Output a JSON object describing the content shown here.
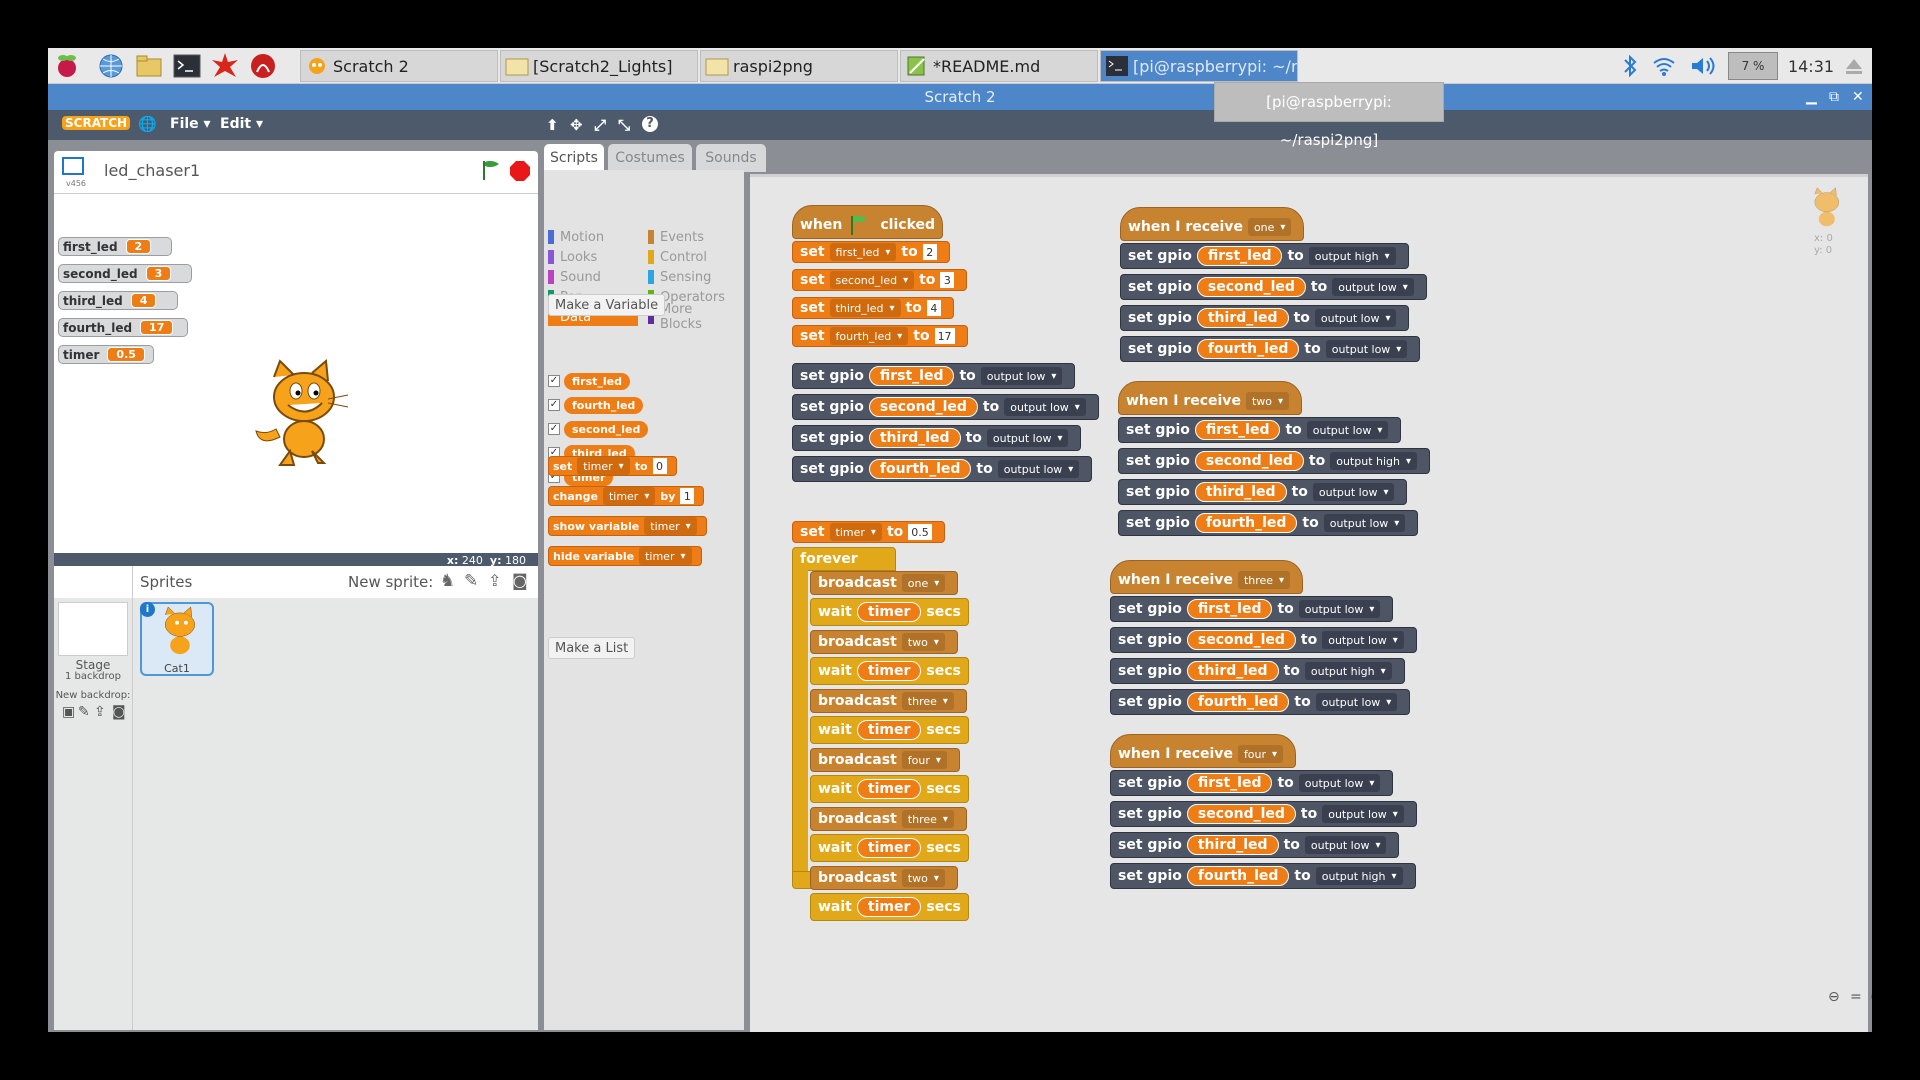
{
  "taskbar": {
    "buttons": [
      {
        "label": "Scratch 2"
      },
      {
        "label": "[Scratch2_Lights]"
      },
      {
        "label": "raspi2png"
      },
      {
        "label": "*README.md"
      },
      {
        "label": "[pi@raspberrypi: ~/ra..."
      }
    ],
    "cpu": "7 %",
    "clock": "14:31",
    "tooltip": "[pi@raspberrypi: ~/raspi2png]"
  },
  "window": {
    "title": "Scratch 2"
  },
  "menu": {
    "logo": "SCRATCH",
    "file": "File",
    "edit": "Edit"
  },
  "stage": {
    "project_name": "led_chaser1",
    "version": "v456",
    "coords_x": "240",
    "coords_y": "180",
    "monitors": [
      {
        "name": "first_led",
        "value": "2"
      },
      {
        "name": "second_led",
        "value": "3"
      },
      {
        "name": "third_led",
        "value": "4"
      },
      {
        "name": "fourth_led",
        "value": "17"
      },
      {
        "name": "timer",
        "value": "0.5"
      }
    ]
  },
  "sprites": {
    "title": "Sprites",
    "new_sprite": "New sprite:",
    "stage_label": "Stage",
    "backdrops": "1 backdrop",
    "new_backdrop": "New backdrop:",
    "sprite_name": "Cat1"
  },
  "tabs": [
    "Scripts",
    "Costumes",
    "Sounds"
  ],
  "palette": {
    "categories": [
      {
        "name": "Motion",
        "color": "#4a6cd4"
      },
      {
        "name": "Events",
        "color": "#c88330"
      },
      {
        "name": "Looks",
        "color": "#8a55d7"
      },
      {
        "name": "Control",
        "color": "#e1a91a"
      },
      {
        "name": "Sound",
        "color": "#bb42c3"
      },
      {
        "name": "Sensing",
        "color": "#2ca5e2"
      },
      {
        "name": "Pen",
        "color": "#0e9a6c"
      },
      {
        "name": "Operators",
        "color": "#5cb712"
      },
      {
        "name": "Data",
        "color": "#ee7d16"
      },
      {
        "name": "More Blocks",
        "color": "#632d99"
      }
    ],
    "make_variable": "Make a Variable",
    "variables": [
      "first_led",
      "fourth_led",
      "second_led",
      "third_led",
      "timer"
    ],
    "set_label": "set",
    "set_var": "timer",
    "set_to": "to",
    "set_value": "0",
    "change_label": "change",
    "change_var": "timer",
    "change_by": "by",
    "change_value": "1",
    "show_label": "show variable",
    "show_var": "timer",
    "hide_label": "hide variable",
    "hide_var": "timer",
    "make_list": "Make a List"
  },
  "scripts": {
    "main": {
      "hat_when": "when",
      "hat_clicked": "clicked",
      "sets": [
        {
          "var": "first_led",
          "value": "2"
        },
        {
          "var": "second_led",
          "value": "3"
        },
        {
          "var": "third_led",
          "value": "4"
        },
        {
          "var": "fourth_led",
          "value": "17"
        }
      ],
      "gpios": [
        {
          "led": "first_led",
          "mode": "output low"
        },
        {
          "led": "second_led",
          "mode": "output low"
        },
        {
          "led": "third_led",
          "mode": "output low"
        },
        {
          "led": "fourth_led",
          "mode": "output low"
        }
      ],
      "timer_var": "timer",
      "timer_value": "0.5",
      "forever": "forever",
      "loop": [
        "one",
        "two",
        "three",
        "four",
        "three",
        "two"
      ],
      "broadcast": "broadcast",
      "wait": "wait",
      "secs": "secs",
      "timer_rep": "timer"
    },
    "receivers": [
      {
        "message": "one",
        "modes": [
          "output high",
          "output low",
          "output low",
          "output low"
        ]
      },
      {
        "message": "two",
        "modes": [
          "output low",
          "output high",
          "output low",
          "output low"
        ]
      },
      {
        "message": "three",
        "modes": [
          "output low",
          "output low",
          "output high",
          "output low"
        ]
      },
      {
        "message": "four",
        "modes": [
          "output low",
          "output low",
          "output low",
          "output high"
        ]
      }
    ],
    "leds": [
      "first_led",
      "second_led",
      "third_led",
      "fourth_led"
    ],
    "when_i_receive": "when I receive",
    "set_gpio": "set gpio",
    "to": "to",
    "sprite_x": "x: 0",
    "sprite_y": "y: 0"
  }
}
